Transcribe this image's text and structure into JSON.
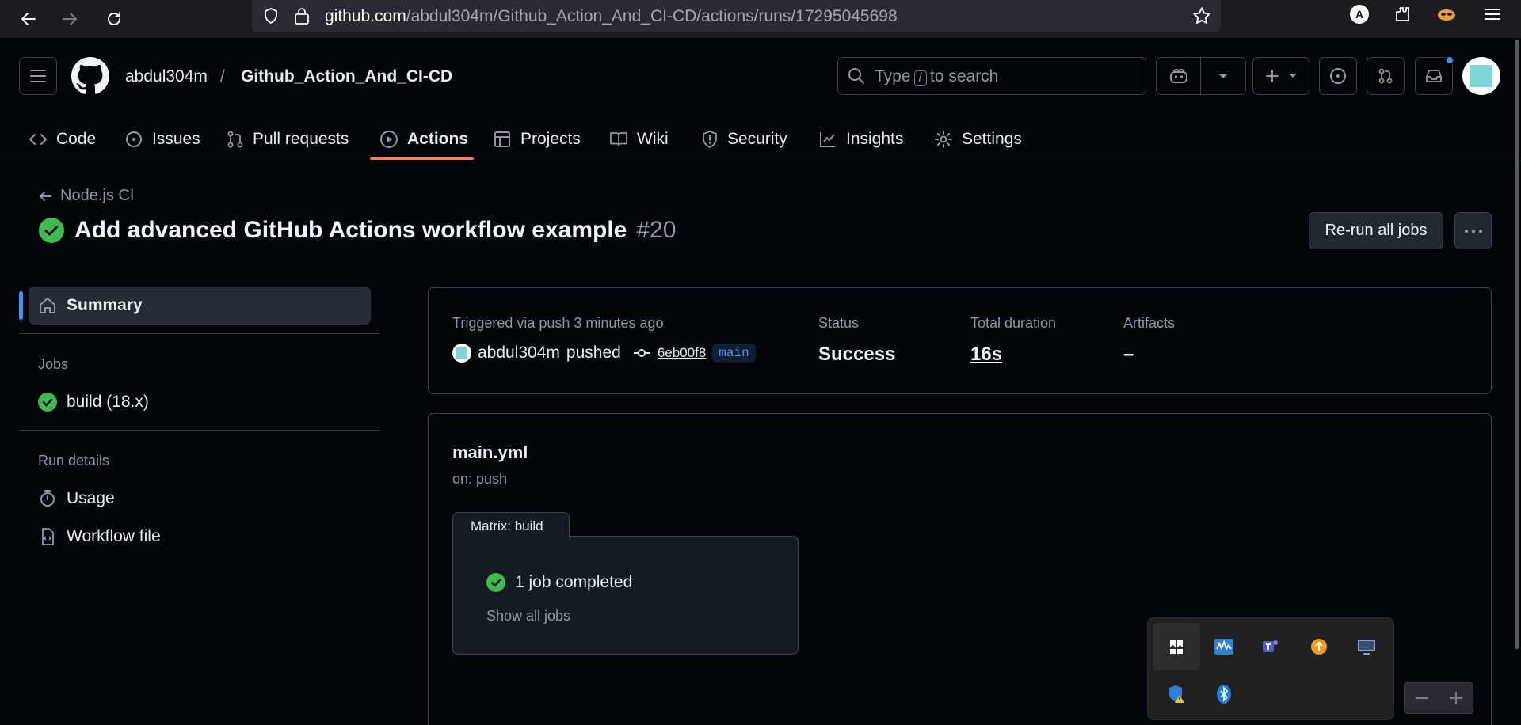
{
  "browser": {
    "url_host": "github.com",
    "url_path": "/abdul304m/Github_Action_And_CI-CD/actions/runs/17295045698",
    "profile_initial": "A"
  },
  "header": {
    "owner": "abdul304m",
    "separator": "/",
    "repo": "Github_Action_And_CI-CD",
    "search_prefix": "Type",
    "search_key": "/",
    "search_suffix": "to search"
  },
  "tabs": [
    {
      "label": "Code",
      "icon": "code-icon"
    },
    {
      "label": "Issues",
      "icon": "issue-icon"
    },
    {
      "label": "Pull requests",
      "icon": "pull-request-icon"
    },
    {
      "label": "Actions",
      "icon": "play-icon",
      "active": true
    },
    {
      "label": "Projects",
      "icon": "table-icon"
    },
    {
      "label": "Wiki",
      "icon": "book-icon"
    },
    {
      "label": "Security",
      "icon": "shield-icon"
    },
    {
      "label": "Insights",
      "icon": "graph-icon"
    },
    {
      "label": "Settings",
      "icon": "gear-icon"
    }
  ],
  "run": {
    "back_label": "Node.js CI",
    "title": "Add advanced GitHub Actions workflow example",
    "number": "#20",
    "rerun_label": "Re-run all jobs"
  },
  "sidebar": {
    "summary_label": "Summary",
    "jobs_heading": "Jobs",
    "job_label": "build (18.x)",
    "details_heading": "Run details",
    "usage_label": "Usage",
    "workflow_label": "Workflow file"
  },
  "summary": {
    "trigger": "Triggered via push 3 minutes ago",
    "actor": "abdul304m",
    "action": "pushed",
    "sha": "6eb00f8",
    "branch": "main",
    "status_label": "Status",
    "status_value": "Success",
    "duration_label": "Total duration",
    "duration_value": "16s",
    "artifacts_label": "Artifacts",
    "artifacts_value": "–"
  },
  "graph": {
    "file": "main.yml",
    "trigger": "on: push",
    "matrix_label": "Matrix: build",
    "jobs_completed": "1 job completed",
    "show_all": "Show all jobs"
  },
  "colors": {
    "success": "#3fb950",
    "accent": "#f78166",
    "link": "#4493f8"
  }
}
